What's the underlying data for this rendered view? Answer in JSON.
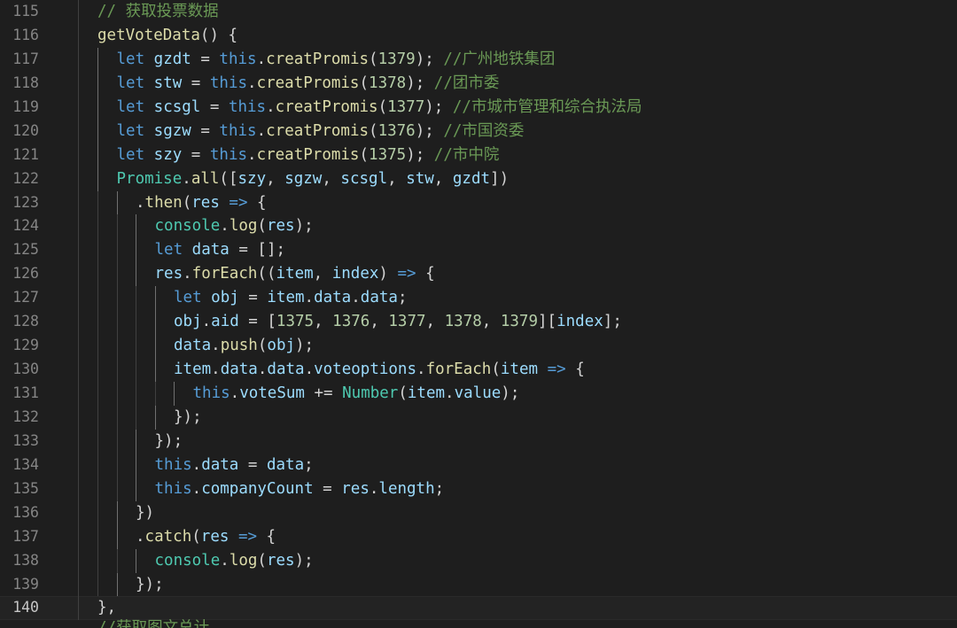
{
  "editor": {
    "theme_colors": {
      "background": "#1e1e1e",
      "keyword": "#569cd6",
      "function": "#dcdcaa",
      "variable": "#9cdcfe",
      "number": "#b5cea8",
      "comment": "#6a9955",
      "class": "#4ec9b0",
      "line_number": "#858585"
    },
    "current_line": 140,
    "lines": [
      {
        "n": "115",
        "indent": 1,
        "tokens": [
          [
            "com",
            "// 获取投票数据"
          ]
        ]
      },
      {
        "n": "116",
        "indent": 1,
        "tokens": [
          [
            "fn",
            "getVoteData"
          ],
          [
            "op",
            "() {"
          ]
        ]
      },
      {
        "n": "117",
        "indent": 2,
        "tokens": [
          [
            "kw",
            "let"
          ],
          [
            "op",
            " "
          ],
          [
            "var",
            "gzdt"
          ],
          [
            "op",
            " = "
          ],
          [
            "kw",
            "this"
          ],
          [
            "op",
            "."
          ],
          [
            "fn",
            "creatPromis"
          ],
          [
            "op",
            "("
          ],
          [
            "num",
            "1379"
          ],
          [
            "op",
            "); "
          ],
          [
            "com",
            "//广州地铁集团"
          ]
        ]
      },
      {
        "n": "118",
        "indent": 2,
        "tokens": [
          [
            "kw",
            "let"
          ],
          [
            "op",
            " "
          ],
          [
            "var",
            "stw"
          ],
          [
            "op",
            " = "
          ],
          [
            "kw",
            "this"
          ],
          [
            "op",
            "."
          ],
          [
            "fn",
            "creatPromis"
          ],
          [
            "op",
            "("
          ],
          [
            "num",
            "1378"
          ],
          [
            "op",
            "); "
          ],
          [
            "com",
            "//团市委"
          ]
        ]
      },
      {
        "n": "119",
        "indent": 2,
        "tokens": [
          [
            "kw",
            "let"
          ],
          [
            "op",
            " "
          ],
          [
            "var",
            "scsgl"
          ],
          [
            "op",
            " = "
          ],
          [
            "kw",
            "this"
          ],
          [
            "op",
            "."
          ],
          [
            "fn",
            "creatPromis"
          ],
          [
            "op",
            "("
          ],
          [
            "num",
            "1377"
          ],
          [
            "op",
            "); "
          ],
          [
            "com",
            "//市城市管理和综合执法局"
          ]
        ]
      },
      {
        "n": "120",
        "indent": 2,
        "tokens": [
          [
            "kw",
            "let"
          ],
          [
            "op",
            " "
          ],
          [
            "var",
            "sgzw"
          ],
          [
            "op",
            " = "
          ],
          [
            "kw",
            "this"
          ],
          [
            "op",
            "."
          ],
          [
            "fn",
            "creatPromis"
          ],
          [
            "op",
            "("
          ],
          [
            "num",
            "1376"
          ],
          [
            "op",
            "); "
          ],
          [
            "com",
            "//市国资委"
          ]
        ]
      },
      {
        "n": "121",
        "indent": 2,
        "tokens": [
          [
            "kw",
            "let"
          ],
          [
            "op",
            " "
          ],
          [
            "var",
            "szy"
          ],
          [
            "op",
            " = "
          ],
          [
            "kw",
            "this"
          ],
          [
            "op",
            "."
          ],
          [
            "fn",
            "creatPromis"
          ],
          [
            "op",
            "("
          ],
          [
            "num",
            "1375"
          ],
          [
            "op",
            "); "
          ],
          [
            "com",
            "//市中院"
          ]
        ]
      },
      {
        "n": "122",
        "indent": 2,
        "tokens": [
          [
            "cls",
            "Promise"
          ],
          [
            "op",
            "."
          ],
          [
            "fn",
            "all"
          ],
          [
            "op",
            "(["
          ],
          [
            "var",
            "szy"
          ],
          [
            "op",
            ", "
          ],
          [
            "var",
            "sgzw"
          ],
          [
            "op",
            ", "
          ],
          [
            "var",
            "scsgl"
          ],
          [
            "op",
            ", "
          ],
          [
            "var",
            "stw"
          ],
          [
            "op",
            ", "
          ],
          [
            "var",
            "gzdt"
          ],
          [
            "op",
            "])"
          ]
        ]
      },
      {
        "n": "123",
        "indent": 3,
        "tokens": [
          [
            "op",
            "."
          ],
          [
            "fn",
            "then"
          ],
          [
            "op",
            "("
          ],
          [
            "var",
            "res"
          ],
          [
            "op",
            " "
          ],
          [
            "kw",
            "=>"
          ],
          [
            "op",
            " {"
          ]
        ]
      },
      {
        "n": "124",
        "indent": 4,
        "tokens": [
          [
            "cls",
            "console"
          ],
          [
            "op",
            "."
          ],
          [
            "fn",
            "log"
          ],
          [
            "op",
            "("
          ],
          [
            "var",
            "res"
          ],
          [
            "op",
            ");"
          ]
        ]
      },
      {
        "n": "125",
        "indent": 4,
        "tokens": [
          [
            "kw",
            "let"
          ],
          [
            "op",
            " "
          ],
          [
            "var",
            "data"
          ],
          [
            "op",
            " = [];"
          ]
        ]
      },
      {
        "n": "126",
        "indent": 4,
        "tokens": [
          [
            "var",
            "res"
          ],
          [
            "op",
            "."
          ],
          [
            "fn",
            "forEach"
          ],
          [
            "op",
            "(("
          ],
          [
            "var",
            "item"
          ],
          [
            "op",
            ", "
          ],
          [
            "var",
            "index"
          ],
          [
            "op",
            ") "
          ],
          [
            "kw",
            "=>"
          ],
          [
            "op",
            " {"
          ]
        ]
      },
      {
        "n": "127",
        "indent": 5,
        "tokens": [
          [
            "kw",
            "let"
          ],
          [
            "op",
            " "
          ],
          [
            "var",
            "obj"
          ],
          [
            "op",
            " = "
          ],
          [
            "var",
            "item"
          ],
          [
            "op",
            "."
          ],
          [
            "var",
            "data"
          ],
          [
            "op",
            "."
          ],
          [
            "var",
            "data"
          ],
          [
            "op",
            ";"
          ]
        ]
      },
      {
        "n": "128",
        "indent": 5,
        "tokens": [
          [
            "var",
            "obj"
          ],
          [
            "op",
            "."
          ],
          [
            "var",
            "aid"
          ],
          [
            "op",
            " = ["
          ],
          [
            "num",
            "1375"
          ],
          [
            "op",
            ", "
          ],
          [
            "num",
            "1376"
          ],
          [
            "op",
            ", "
          ],
          [
            "num",
            "1377"
          ],
          [
            "op",
            ", "
          ],
          [
            "num",
            "1378"
          ],
          [
            "op",
            ", "
          ],
          [
            "num",
            "1379"
          ],
          [
            "op",
            "]["
          ],
          [
            "var",
            "index"
          ],
          [
            "op",
            "];"
          ]
        ]
      },
      {
        "n": "129",
        "indent": 5,
        "tokens": [
          [
            "var",
            "data"
          ],
          [
            "op",
            "."
          ],
          [
            "fn",
            "push"
          ],
          [
            "op",
            "("
          ],
          [
            "var",
            "obj"
          ],
          [
            "op",
            ");"
          ]
        ]
      },
      {
        "n": "130",
        "indent": 5,
        "tokens": [
          [
            "var",
            "item"
          ],
          [
            "op",
            "."
          ],
          [
            "var",
            "data"
          ],
          [
            "op",
            "."
          ],
          [
            "var",
            "data"
          ],
          [
            "op",
            "."
          ],
          [
            "var",
            "voteoptions"
          ],
          [
            "op",
            "."
          ],
          [
            "fn",
            "forEach"
          ],
          [
            "op",
            "("
          ],
          [
            "var",
            "item"
          ],
          [
            "op",
            " "
          ],
          [
            "kw",
            "=>"
          ],
          [
            "op",
            " {"
          ]
        ]
      },
      {
        "n": "131",
        "indent": 6,
        "tokens": [
          [
            "kw",
            "this"
          ],
          [
            "op",
            "."
          ],
          [
            "var",
            "voteSum"
          ],
          [
            "op",
            " += "
          ],
          [
            "cls",
            "Number"
          ],
          [
            "op",
            "("
          ],
          [
            "var",
            "item"
          ],
          [
            "op",
            "."
          ],
          [
            "var",
            "value"
          ],
          [
            "op",
            ");"
          ]
        ]
      },
      {
        "n": "132",
        "indent": 5,
        "tokens": [
          [
            "op",
            "});"
          ]
        ]
      },
      {
        "n": "133",
        "indent": 4,
        "tokens": [
          [
            "op",
            "});"
          ]
        ]
      },
      {
        "n": "134",
        "indent": 4,
        "tokens": [
          [
            "kw",
            "this"
          ],
          [
            "op",
            "."
          ],
          [
            "var",
            "data"
          ],
          [
            "op",
            " = "
          ],
          [
            "var",
            "data"
          ],
          [
            "op",
            ";"
          ]
        ]
      },
      {
        "n": "135",
        "indent": 4,
        "tokens": [
          [
            "kw",
            "this"
          ],
          [
            "op",
            "."
          ],
          [
            "var",
            "companyCount"
          ],
          [
            "op",
            " = "
          ],
          [
            "var",
            "res"
          ],
          [
            "op",
            "."
          ],
          [
            "var",
            "length"
          ],
          [
            "op",
            ";"
          ]
        ]
      },
      {
        "n": "136",
        "indent": 3,
        "tokens": [
          [
            "op",
            "})"
          ]
        ]
      },
      {
        "n": "137",
        "indent": 3,
        "tokens": [
          [
            "op",
            "."
          ],
          [
            "fn",
            "catch"
          ],
          [
            "op",
            "("
          ],
          [
            "var",
            "res"
          ],
          [
            "op",
            " "
          ],
          [
            "kw",
            "=>"
          ],
          [
            "op",
            " {"
          ]
        ]
      },
      {
        "n": "138",
        "indent": 4,
        "tokens": [
          [
            "cls",
            "console"
          ],
          [
            "op",
            "."
          ],
          [
            "fn",
            "log"
          ],
          [
            "op",
            "("
          ],
          [
            "var",
            "res"
          ],
          [
            "op",
            ");"
          ]
        ]
      },
      {
        "n": "139",
        "indent": 3,
        "tokens": [
          [
            "op",
            "});"
          ]
        ]
      },
      {
        "n": "140",
        "indent": 1,
        "tokens": [
          [
            "op",
            "},"
          ]
        ]
      }
    ],
    "partial_next_line": "//获取图文总计"
  }
}
